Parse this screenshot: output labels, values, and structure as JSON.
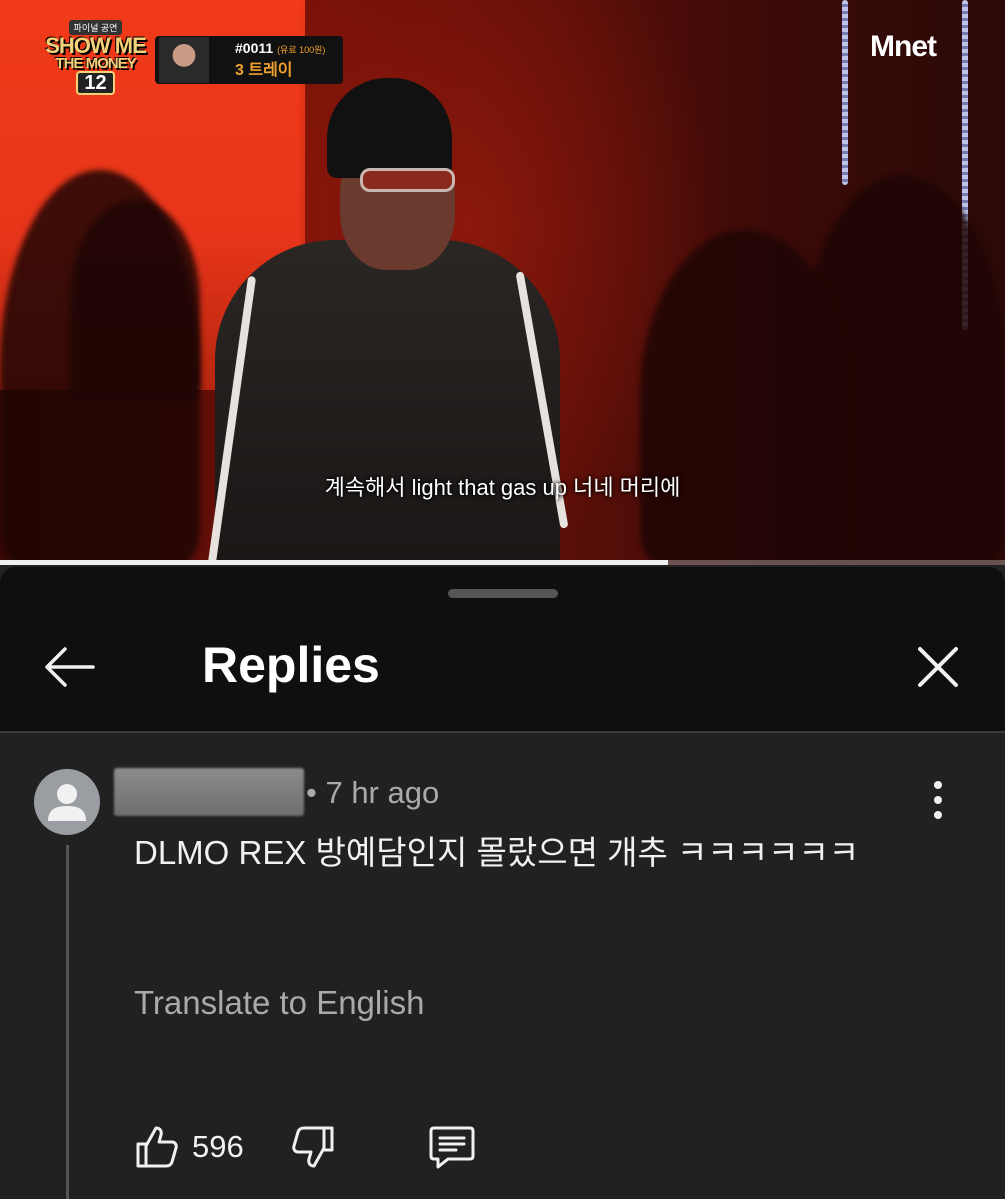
{
  "video": {
    "subtitle": "계속해서 light that gas up 너네 머리에",
    "show_logo": {
      "small_text": "파이널 공연",
      "title_line1": "SHOW ME",
      "title_line2": "THE MONEY",
      "number": "12"
    },
    "contestant": {
      "code": "#0011",
      "price_note": "(유료 100원)",
      "name": "3 트레이"
    },
    "channel_logo": "Mnet",
    "progress": 0.665
  },
  "sheet": {
    "title": "Replies"
  },
  "comment": {
    "timestamp": "• 7 hr ago",
    "text": "DLMO REX 방예담인지 몰랐으면 개추 ㅋㅋㅋㅋㅋㅋ",
    "translate_label": "Translate to English",
    "like_count": "596"
  },
  "colors": {
    "sheet_background": "#212121",
    "header_background": "#0f0f0f",
    "secondary_text": "#aaaaaa",
    "primary_text": "#f1f1f1"
  },
  "icons": [
    "back-arrow-icon",
    "close-icon",
    "more-vert-icon",
    "thumb-up-icon",
    "thumb-down-icon",
    "reply-comment-icon",
    "avatar-person-icon"
  ]
}
